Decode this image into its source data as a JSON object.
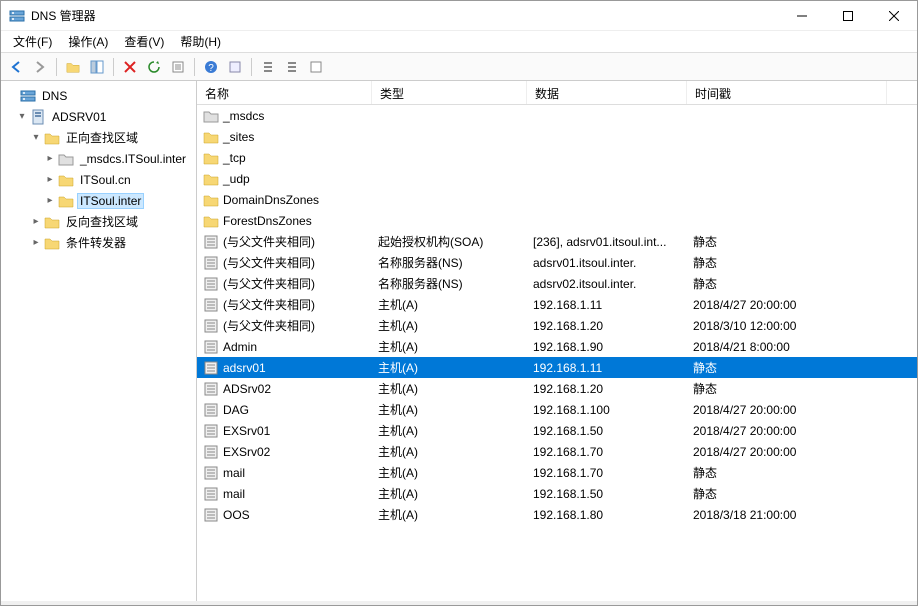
{
  "window": {
    "title": "DNS 管理器"
  },
  "menu": {
    "file": "文件(F)",
    "action": "操作(A)",
    "view": "查看(V)",
    "help": "帮助(H)"
  },
  "tree": {
    "root": "DNS",
    "server": "ADSRV01",
    "fwd_zone": "正向查找区域",
    "zone1": "_msdcs.ITSoul.inter",
    "zone2": "ITSoul.cn",
    "zone3": "ITSoul.inter",
    "rev_zone": "反向查找区域",
    "cond_fwd": "条件转发器"
  },
  "columns": {
    "name": "名称",
    "type": "类型",
    "data": "数据",
    "timestamp": "时间戳"
  },
  "rows": [
    {
      "name": "_msdcs",
      "type": "",
      "data": "",
      "ts": "",
      "icon": "folder-gray"
    },
    {
      "name": "_sites",
      "type": "",
      "data": "",
      "ts": "",
      "icon": "folder"
    },
    {
      "name": "_tcp",
      "type": "",
      "data": "",
      "ts": "",
      "icon": "folder"
    },
    {
      "name": "_udp",
      "type": "",
      "data": "",
      "ts": "",
      "icon": "folder"
    },
    {
      "name": "DomainDnsZones",
      "type": "",
      "data": "",
      "ts": "",
      "icon": "folder"
    },
    {
      "name": "ForestDnsZones",
      "type": "",
      "data": "",
      "ts": "",
      "icon": "folder"
    },
    {
      "name": "(与父文件夹相同)",
      "type": "起始授权机构(SOA)",
      "data": "[236], adsrv01.itsoul.int...",
      "ts": "静态",
      "icon": "rec"
    },
    {
      "name": "(与父文件夹相同)",
      "type": "名称服务器(NS)",
      "data": "adsrv01.itsoul.inter.",
      "ts": "静态",
      "icon": "rec"
    },
    {
      "name": "(与父文件夹相同)",
      "type": "名称服务器(NS)",
      "data": "adsrv02.itsoul.inter.",
      "ts": "静态",
      "icon": "rec"
    },
    {
      "name": "(与父文件夹相同)",
      "type": "主机(A)",
      "data": "192.168.1.11",
      "ts": "2018/4/27 20:00:00",
      "icon": "rec"
    },
    {
      "name": "(与父文件夹相同)",
      "type": "主机(A)",
      "data": "192.168.1.20",
      "ts": "2018/3/10 12:00:00",
      "icon": "rec"
    },
    {
      "name": "Admin",
      "type": "主机(A)",
      "data": "192.168.1.90",
      "ts": "2018/4/21 8:00:00",
      "icon": "rec"
    },
    {
      "name": "adsrv01",
      "type": "主机(A)",
      "data": "192.168.1.11",
      "ts": "静态",
      "icon": "rec",
      "selected": true
    },
    {
      "name": "ADSrv02",
      "type": "主机(A)",
      "data": "192.168.1.20",
      "ts": "静态",
      "icon": "rec"
    },
    {
      "name": "DAG",
      "type": "主机(A)",
      "data": "192.168.1.100",
      "ts": "2018/4/27 20:00:00",
      "icon": "rec"
    },
    {
      "name": "EXSrv01",
      "type": "主机(A)",
      "data": "192.168.1.50",
      "ts": "2018/4/27 20:00:00",
      "icon": "rec"
    },
    {
      "name": "EXSrv02",
      "type": "主机(A)",
      "data": "192.168.1.70",
      "ts": "2018/4/27 20:00:00",
      "icon": "rec"
    },
    {
      "name": "mail",
      "type": "主机(A)",
      "data": "192.168.1.70",
      "ts": "静态",
      "icon": "rec"
    },
    {
      "name": "mail",
      "type": "主机(A)",
      "data": "192.168.1.50",
      "ts": "静态",
      "icon": "rec"
    },
    {
      "name": "OOS",
      "type": "主机(A)",
      "data": "192.168.1.80",
      "ts": "2018/3/18 21:00:00",
      "icon": "rec"
    }
  ]
}
